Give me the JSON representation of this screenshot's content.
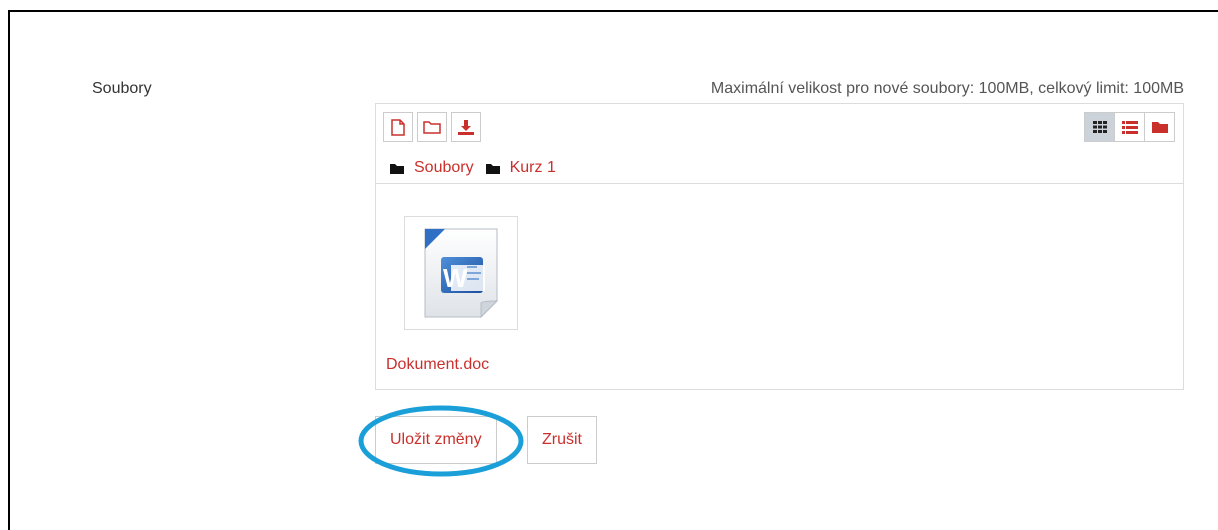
{
  "form": {
    "field_label": "Soubory",
    "limit_text": "Maximální velikost pro nové soubory: 100MB, celkový limit: 100MB"
  },
  "toolbar": {
    "buttons": [
      {
        "icon": "file-add-icon"
      },
      {
        "icon": "folder-create-icon"
      },
      {
        "icon": "download-icon"
      }
    ],
    "views": [
      {
        "icon": "grid-view-icon",
        "active": true
      },
      {
        "icon": "list-view-icon",
        "active": false
      },
      {
        "icon": "folder-view-icon",
        "active": false
      }
    ]
  },
  "breadcrumb": [
    {
      "label": "Soubory"
    },
    {
      "label": "Kurz 1"
    }
  ],
  "files": [
    {
      "name": "Dokument.doc",
      "icon": "word-document-icon"
    }
  ],
  "actions": {
    "save_label": "Uložit změny",
    "cancel_label": "Zrušit"
  },
  "colors": {
    "accent": "#c9302c",
    "highlight": "#1a9fd8",
    "active_view_bg": "#cbd2da"
  }
}
